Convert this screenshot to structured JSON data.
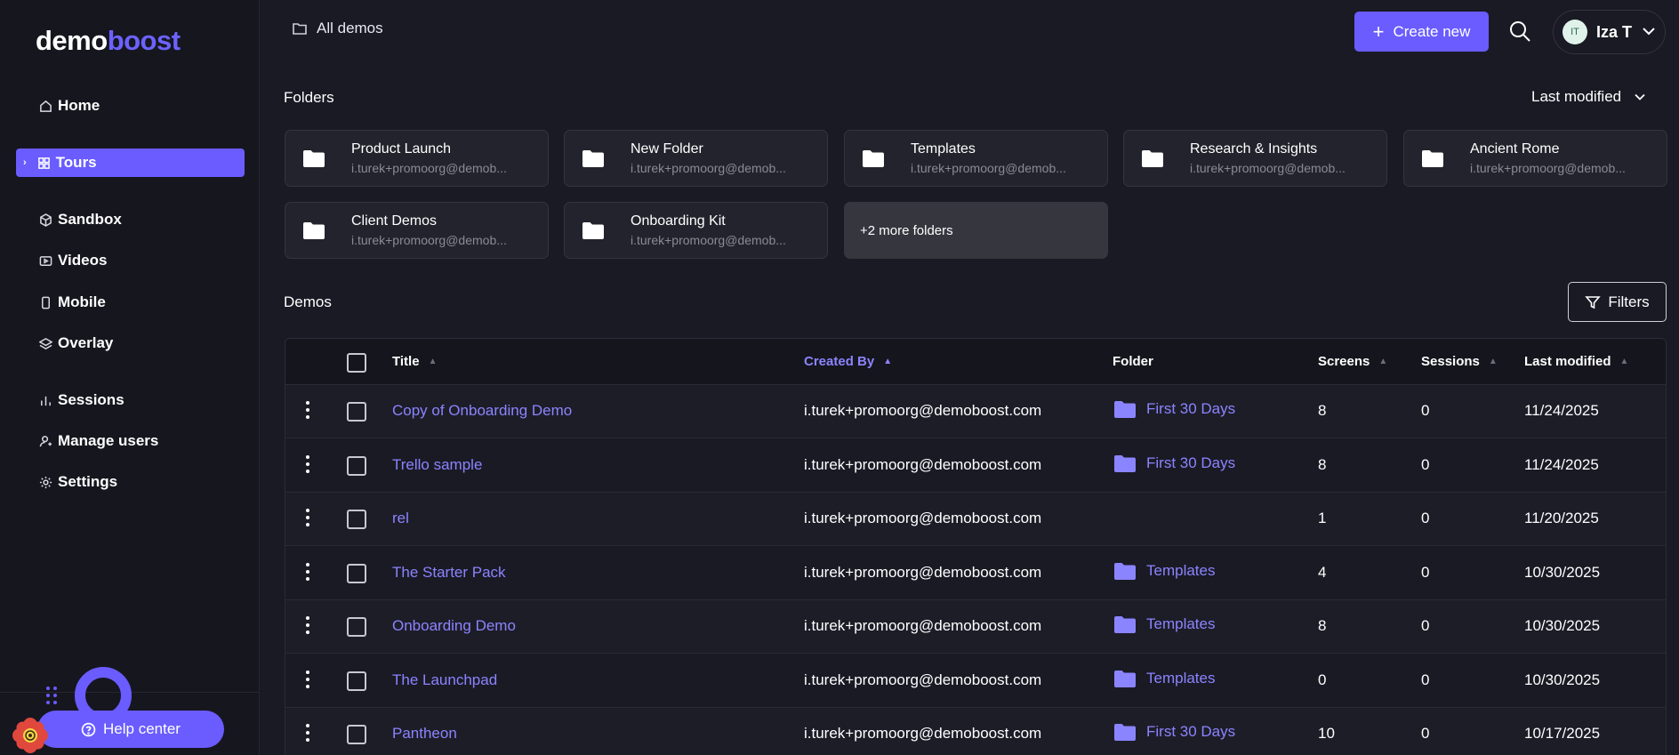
{
  "brand": {
    "part1": "demo",
    "part2": "boost",
    "accent": "#6a5cff"
  },
  "sidebar": {
    "items": [
      {
        "label": "Home",
        "icon": "home-icon"
      },
      {
        "label": "Tours",
        "icon": "grid-icon",
        "active": true
      },
      {
        "label": "Sandbox",
        "icon": "cube-icon"
      },
      {
        "label": "Videos",
        "icon": "video-icon"
      },
      {
        "label": "Mobile",
        "icon": "mobile-icon"
      },
      {
        "label": "Overlay",
        "icon": "layers-icon"
      },
      {
        "label": "Sessions",
        "icon": "bar-chart-icon"
      },
      {
        "label": "Manage users",
        "icon": "user-icon"
      },
      {
        "label": "Settings",
        "icon": "gear-icon"
      }
    ],
    "help_label": "Help center"
  },
  "topbar": {
    "breadcrumb": "All demos",
    "create_label": "Create new",
    "user_initials": "IT",
    "user_name": "Iza T"
  },
  "folders_section": {
    "title": "Folders",
    "sort_label": "Last modified",
    "folders": [
      {
        "name": "Product Launch",
        "owner": "i.turek+promoorg@demob..."
      },
      {
        "name": "New Folder",
        "owner": "i.turek+promoorg@demob..."
      },
      {
        "name": "Templates",
        "owner": "i.turek+promoorg@demob..."
      },
      {
        "name": "Research & Insights",
        "owner": "i.turek+promoorg@demob..."
      },
      {
        "name": "Ancient Rome",
        "owner": "i.turek+promoorg@demob..."
      },
      {
        "name": "Client Demos",
        "owner": "i.turek+promoorg@demob..."
      },
      {
        "name": "Onboarding Kit",
        "owner": "i.turek+promoorg@demob..."
      }
    ],
    "more_label": "+2 more folders"
  },
  "demos_section": {
    "title": "Demos",
    "filters_label": "Filters",
    "columns": {
      "title": "Title",
      "created_by": "Created By",
      "folder": "Folder",
      "screens": "Screens",
      "sessions": "Sessions",
      "last_modified": "Last modified"
    },
    "rows": [
      {
        "title": "Copy of Onboarding Demo",
        "created_by": "i.turek+promoorg@demoboost.com",
        "folder": "First 30 Days",
        "screens": "8",
        "sessions": "0",
        "last_modified": "11/24/2025"
      },
      {
        "title": "Trello sample",
        "created_by": "i.turek+promoorg@demoboost.com",
        "folder": "First 30 Days",
        "screens": "8",
        "sessions": "0",
        "last_modified": "11/24/2025"
      },
      {
        "title": "rel",
        "created_by": "i.turek+promoorg@demoboost.com",
        "folder": "",
        "screens": "1",
        "sessions": "0",
        "last_modified": "11/20/2025"
      },
      {
        "title": "The Starter Pack",
        "created_by": "i.turek+promoorg@demoboost.com",
        "folder": "Templates",
        "screens": "4",
        "sessions": "0",
        "last_modified": "10/30/2025"
      },
      {
        "title": "Onboarding Demo",
        "created_by": "i.turek+promoorg@demoboost.com",
        "folder": "Templates",
        "screens": "8",
        "sessions": "0",
        "last_modified": "10/30/2025"
      },
      {
        "title": "The Launchpad",
        "created_by": "i.turek+promoorg@demoboost.com",
        "folder": "Templates",
        "screens": "0",
        "sessions": "0",
        "last_modified": "10/30/2025"
      },
      {
        "title": "Pantheon",
        "created_by": "i.turek+promoorg@demoboost.com",
        "folder": "First 30 Days",
        "screens": "10",
        "sessions": "0",
        "last_modified": "10/17/2025"
      }
    ]
  }
}
